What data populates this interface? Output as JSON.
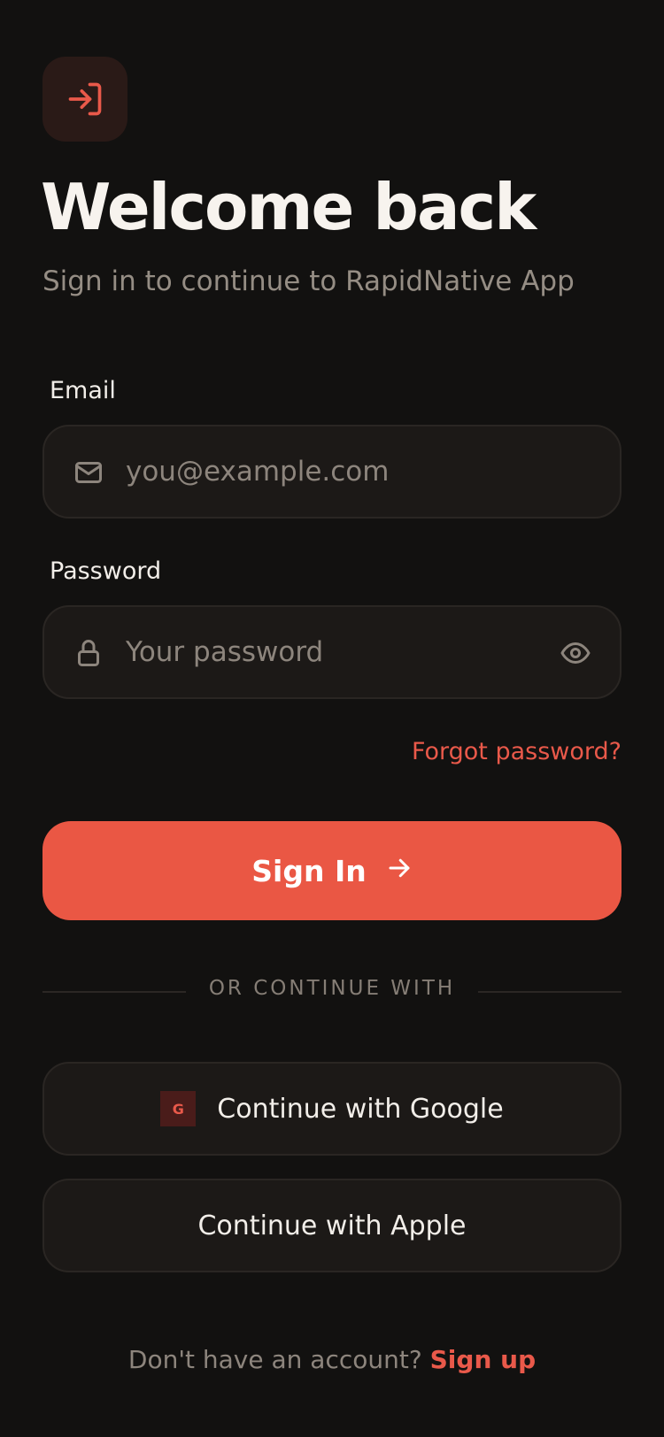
{
  "header": {
    "title": "Welcome back",
    "subtitle": "Sign in to continue to RapidNative App",
    "app_icon": "login-arrow-icon"
  },
  "form": {
    "email": {
      "label": "Email",
      "placeholder": "you@example.com",
      "value": "",
      "icon": "mail-icon"
    },
    "password": {
      "label": "Password",
      "placeholder": "Your password",
      "value": "",
      "icon": "lock-icon",
      "toggle_icon": "eye-icon"
    },
    "forgot_label": "Forgot password?",
    "submit_label": "Sign In"
  },
  "divider": {
    "text": "OR CONTINUE WITH"
  },
  "social": {
    "google_label": "Continue with Google",
    "google_badge": "G",
    "apple_label": "Continue with Apple"
  },
  "footer": {
    "prompt": "Don't have an account?",
    "link": "Sign up"
  },
  "colors": {
    "background": "#121110",
    "accent": "#ea5744",
    "field_background": "#1c1917",
    "muted_text": "#8d857d"
  }
}
